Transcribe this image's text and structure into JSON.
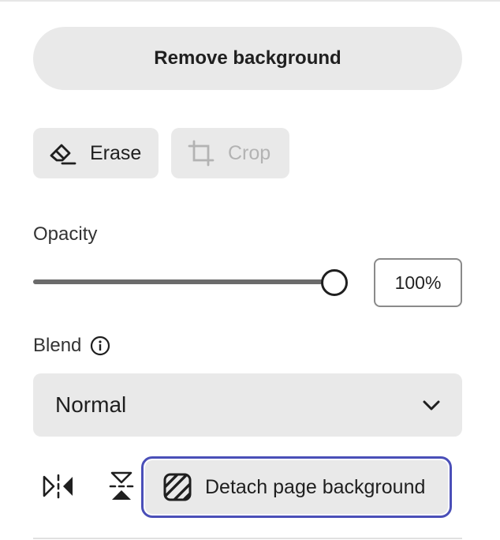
{
  "panel": {
    "remove_background_label": "Remove background",
    "tools": {
      "erase_label": "Erase",
      "crop_label": "Crop",
      "erase_icon": "eraser-icon",
      "crop_icon": "crop-icon"
    },
    "opacity": {
      "label": "Opacity",
      "value": "100%",
      "fraction": 1.0
    },
    "blend": {
      "label": "Blend",
      "info_icon": "info-icon",
      "selected": "Normal",
      "chevron_icon": "chevron-down-icon"
    },
    "actions": {
      "flip_horizontal_icon": "flip-horizontal-icon",
      "flip_vertical_icon": "flip-vertical-icon",
      "detach_label": "Detach page background",
      "detach_icon": "hatch-icon"
    }
  },
  "colors": {
    "button_bg": "#e9e9e9",
    "focus_ring": "#4a4fb8",
    "disabled_text": "#b3b3b3"
  }
}
